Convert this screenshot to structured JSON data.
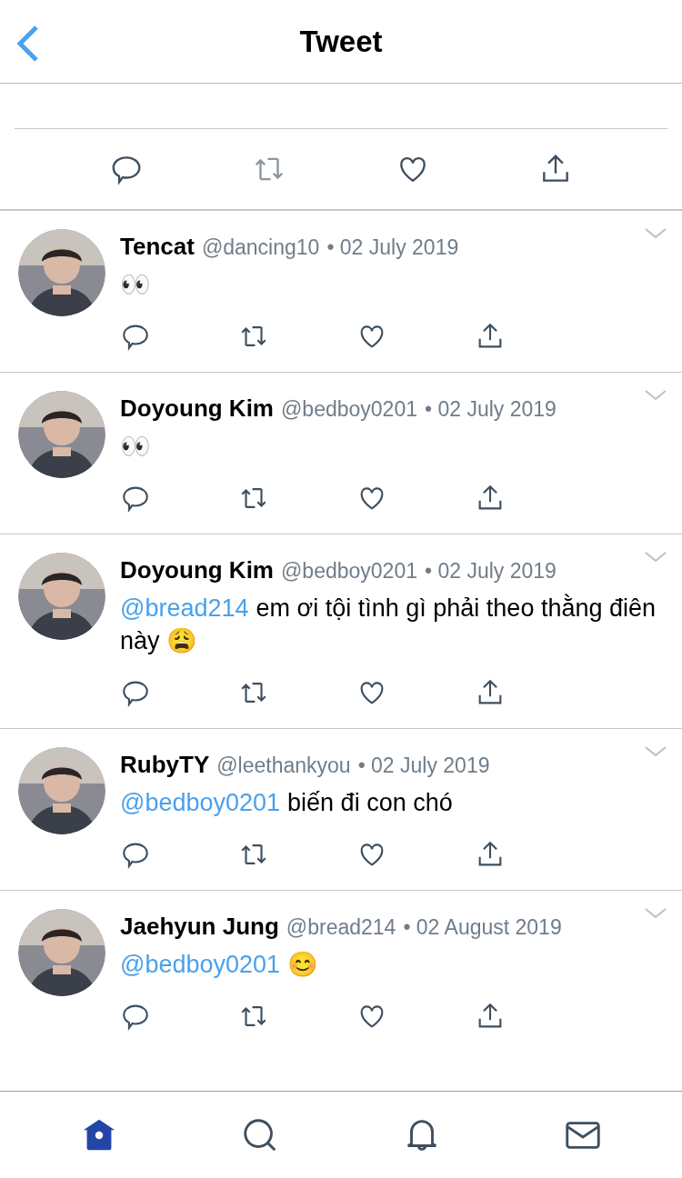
{
  "header": {
    "title": "Tweet"
  },
  "nav": [
    {
      "kind": "home",
      "selected": true
    },
    {
      "kind": "search",
      "selected": false
    },
    {
      "kind": "notifications",
      "selected": false
    },
    {
      "kind": "messages",
      "selected": false
    }
  ],
  "replies": [
    {
      "name": "Tencat",
      "handle": "@dancing10",
      "date": "• 02 July 2019",
      "text": "👀"
    },
    {
      "name": "Doyoung Kim",
      "handle": "@bedboy0201",
      "date": "• 02 July 2019",
      "text": "👀"
    },
    {
      "name": "Doyoung Kim",
      "handle": "@bedboy0201",
      "date": "• 02 July 2019",
      "mention": "@bread214",
      "text": "em ơi tội tình gì phải theo thằng điên này 😩"
    },
    {
      "name": "RubyTY",
      "handle": "@leethankyou",
      "date": "• 02 July 2019",
      "mention": "@bedboy0201",
      "text": "biến đi con chó"
    },
    {
      "name": "Jaehyun Jung",
      "handle": "@bread214",
      "date": "• 02 August 2019",
      "mention": "@bedboy0201",
      "text": "😊"
    }
  ]
}
